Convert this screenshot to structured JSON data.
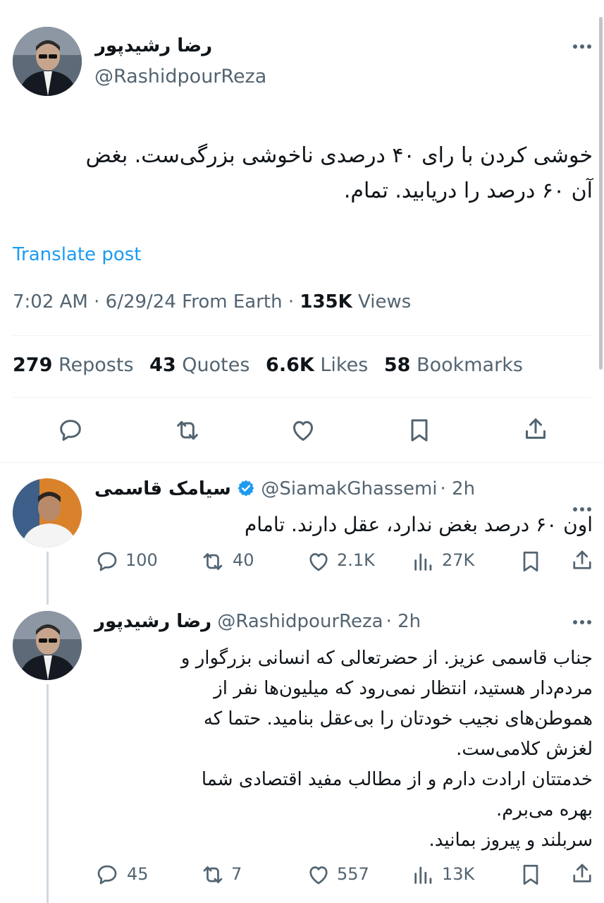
{
  "main_post": {
    "author_name": "رضا رشیدپور",
    "handle": "@RashidpourReza",
    "text_line1": "خوشی کردن با رای ۴۰ درصدی ناخوشی بزرگی‌ست. بغض",
    "text_line2": "آن ۶۰ درصد را دریابید. تمام.",
    "translate": "Translate post",
    "time": "7:02 AM · 6/29/24 From Earth · ",
    "views_num": "135K",
    "views_label": " Views",
    "reposts_num": "279",
    "reposts_label": "Reposts",
    "quotes_num": "43",
    "quotes_label": "Quotes",
    "likes_num": "6.6K",
    "likes_label": "Likes",
    "bookmarks_num": "58",
    "bookmarks_label": "Bookmarks"
  },
  "reply1": {
    "author_name": "سیامک قاسمی",
    "handle": "@SiamakGhassemi",
    "time": "· 2h",
    "text": "اون ۶۰ درصد بغض ندارد، عقل دارند. تامام",
    "replies": "100",
    "reposts": "40",
    "likes": "2.1K",
    "views": "27K"
  },
  "reply2": {
    "author_name": "رضا رشیدپور",
    "handle": "@RashidpourReza",
    "time": "· 2h",
    "lines": [
      "جناب قاسمی عزیز. از حضرتعالی که انسانی بزرگوار و",
      "مردم‌دار هستید، انتظار نمی‌رود که میلیون‌ها نفر از",
      "هموطن‌های نجیب خودتان را بی‌عقل بنامید. حتما که",
      "لغزش کلامی‌ست.",
      "خدمتتان ارادت دارم و از مطالب مفید اقتصادی شما",
      "بهره می‌برم.",
      "سربلند و پیروز بمانید."
    ],
    "replies": "45",
    "reposts": "7",
    "likes": "557",
    "views": "13K"
  },
  "colors": {
    "link": "#1d9bf0",
    "verified": "#1d9bf0",
    "secondary": "#536471"
  }
}
